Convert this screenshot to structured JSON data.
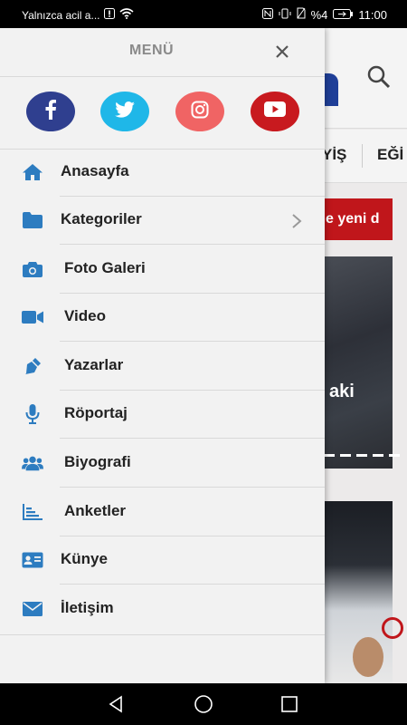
{
  "status_bar": {
    "notification_text": "Yalnızca acil a...",
    "battery_text": "%4",
    "time": "11:00"
  },
  "background": {
    "nav_items": [
      "YİŞ",
      "EĞİ"
    ],
    "ticker_text": "e yeni d",
    "photo_caption": "aki"
  },
  "drawer": {
    "title": "MENÜ",
    "social": [
      {
        "name": "facebook-icon",
        "color": "#2f3f8f"
      },
      {
        "name": "twitter-icon",
        "color": "#1fb7e8"
      },
      {
        "name": "instagram-icon",
        "color": "#f06464"
      },
      {
        "name": "youtube-icon",
        "color": "#c81a1f"
      }
    ],
    "items": [
      {
        "label": "Anasayfa",
        "icon": "home-icon"
      },
      {
        "label": "Kategoriler",
        "icon": "folder-icon"
      },
      {
        "label": "Foto Galeri",
        "icon": "camera-icon"
      },
      {
        "label": "Video",
        "icon": "video-camera-icon"
      },
      {
        "label": "Yazarlar",
        "icon": "pen-nib-icon"
      },
      {
        "label": "Röportaj",
        "icon": "microphone-icon"
      },
      {
        "label": "Biyografi",
        "icon": "users-icon"
      },
      {
        "label": "Anketler",
        "icon": "bar-chart-icon"
      },
      {
        "label": "Künye",
        "icon": "id-card-icon"
      },
      {
        "label": "İletişim",
        "icon": "envelope-icon"
      }
    ],
    "accent_color": "#2d7cc0"
  }
}
